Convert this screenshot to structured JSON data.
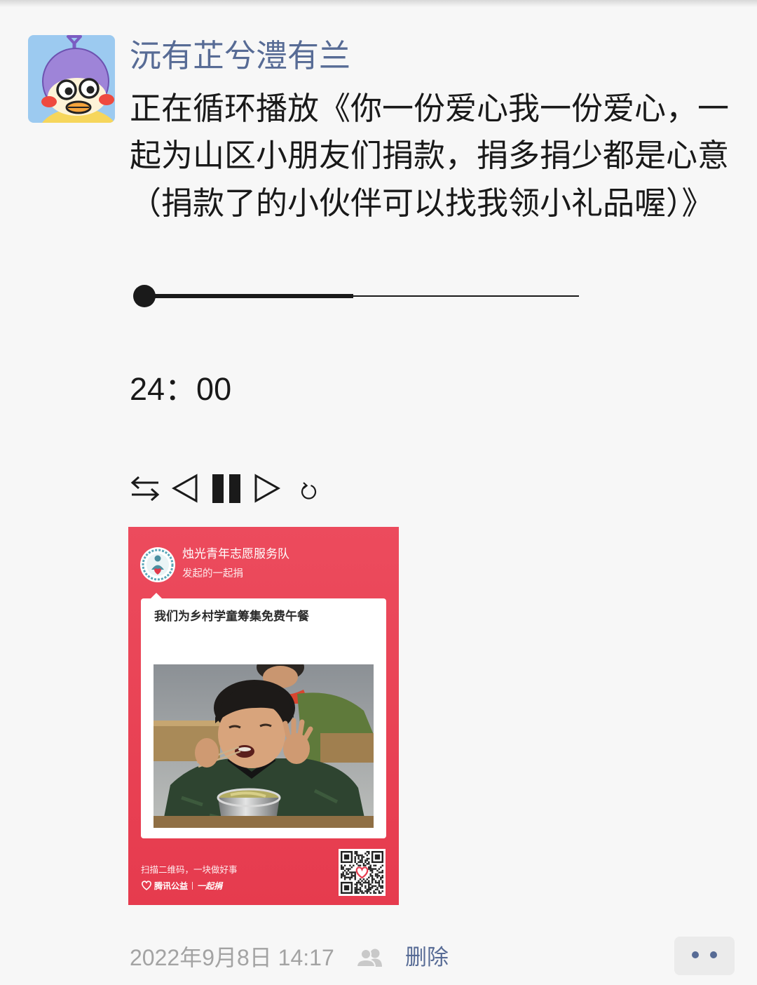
{
  "theme": {
    "page_bg": "#f7f7f7",
    "link": "#576b95",
    "text": "#191919",
    "meta": "#a3a3a3",
    "poster_red": "#e63b4e"
  },
  "post": {
    "author": "沅有芷兮澧有兰",
    "text_lines": [
      "正在循环播放《你一份爱心我一份爱心，一",
      "起为山区小朋友们捐款，捐多捐少都是心意",
      "（捐款了的小伙伴可以找我领小礼品喔）》"
    ],
    "player": {
      "progress": 0.48,
      "time": "24：00",
      "controls": [
        "loop-mode-icon",
        "previous-icon",
        "pause-icon",
        "next-icon",
        "repeat-icon"
      ]
    },
    "share_card": {
      "organizer": "烛光青年志愿服务队",
      "subtitle": "发起的一起捐",
      "headline": "我们为乡村学童筹集免费午餐",
      "footer_text": "扫描二维码，一块做好事",
      "brand": "腾讯公益",
      "brand_product": "一起捐"
    },
    "footer": {
      "timestamp": "2022年9月8日 14:17",
      "visibility_icon": "friends-visibility-icon",
      "delete_label": "删除",
      "more_icon": "more-dots-icon"
    }
  }
}
